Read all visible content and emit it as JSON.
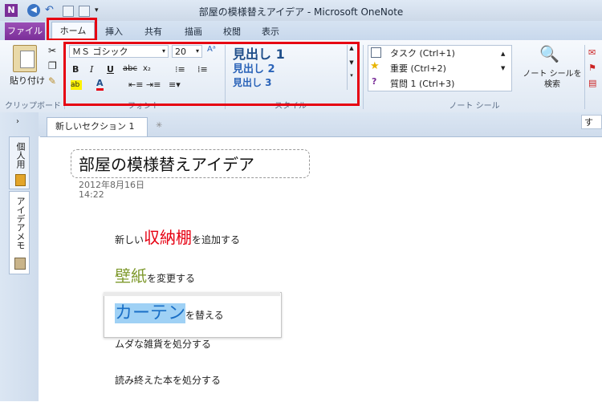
{
  "window": {
    "title": "部屋の模様替えアイデア - Microsoft OneNote"
  },
  "tabs": [
    "ファイル",
    "ホーム",
    "挿入",
    "共有",
    "描画",
    "校閲",
    "表示"
  ],
  "ribbon": {
    "clipboard": {
      "paste_label": "貼り付け",
      "group_label": "クリップボード"
    },
    "font": {
      "name": "ＭＳ ゴシック",
      "size": "20",
      "group_label": "フォント",
      "bold": "B",
      "italic": "I",
      "underline": "U",
      "strike": "abc",
      "subscript": "x₂"
    },
    "styles": {
      "items": [
        "見出し 1",
        "見出し 2",
        "見出し 3"
      ],
      "group_label": "スタイル"
    },
    "note_tags": {
      "items": [
        "タスク (Ctrl+1)",
        "重要 (Ctrl+2)",
        "質問 1 (Ctrl+3)"
      ],
      "search_label": "ノート シールを\n検索",
      "group_label": "ノート シール"
    }
  },
  "nav": {
    "notebook": "個人用",
    "notebook2": "アイデアメモ"
  },
  "section_tab": "新しいセクション 1",
  "search_placeholder": "すべ",
  "page": {
    "title": "部屋の模様替えアイデア",
    "date": "2012年8月16日",
    "time": "14:22",
    "notes": [
      {
        "prefix": "新しい",
        "emph": "収納棚",
        "suffix": "を追加する"
      },
      {
        "prefix": "",
        "emph": "壁紙",
        "suffix": "を変更する"
      },
      {
        "prefix": "",
        "emph": "カーテン",
        "suffix": "を替える"
      },
      {
        "text": "ムダな雑貨を処分する"
      },
      {
        "text": "読み終えた本を処分する"
      }
    ]
  },
  "colors": {
    "highlight_red": "#e60012",
    "file_tab": "#7a2e98",
    "emph1": "#e60012",
    "emph2": "#7f9a2e",
    "emph3": "#1a6fc6",
    "selection": "#9fd1f5"
  }
}
